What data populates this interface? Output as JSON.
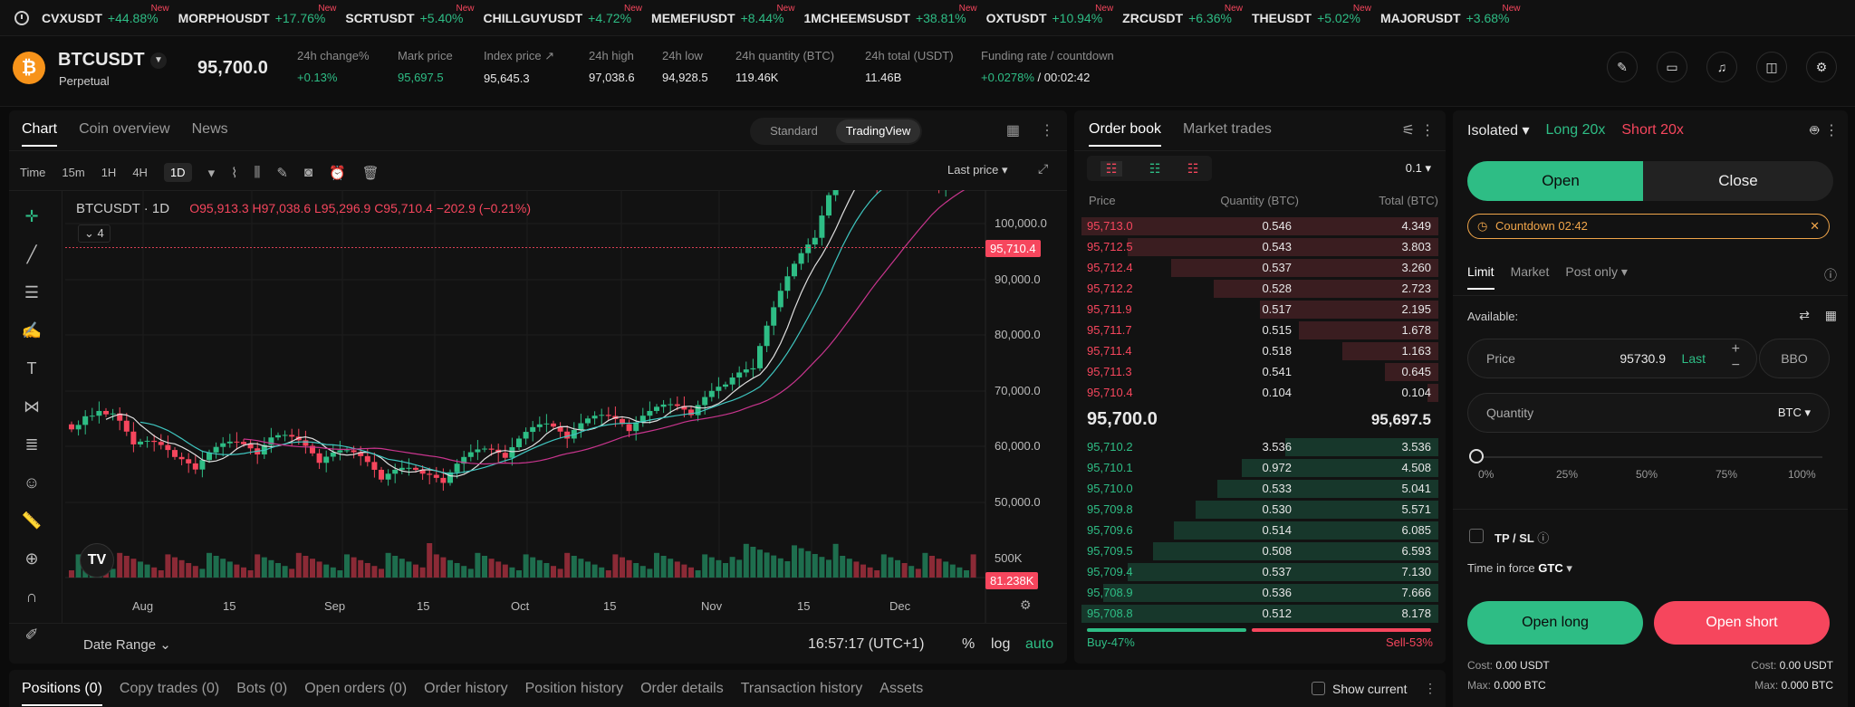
{
  "ticker": [
    {
      "sym": "CVXUSDT",
      "chg": "+44.88%",
      "new": "New"
    },
    {
      "sym": "MORPHOUSDT",
      "chg": "+17.76%",
      "new": "New"
    },
    {
      "sym": "SCRTUSDT",
      "chg": "+5.40%",
      "new": "New"
    },
    {
      "sym": "CHILLGUYUSDT",
      "chg": "+4.72%",
      "new": "New"
    },
    {
      "sym": "MEMEFIUSDT",
      "chg": "+8.44%",
      "new": "New"
    },
    {
      "sym": "1MCHEEMSUSDT",
      "chg": "+38.81%",
      "new": "New"
    },
    {
      "sym": "OXTUSDT",
      "chg": "+10.94%",
      "new": "New"
    },
    {
      "sym": "ZRCUSDT",
      "chg": "+6.36%",
      "new": "New"
    },
    {
      "sym": "THEUSDT",
      "chg": "+5.02%",
      "new": "New"
    },
    {
      "sym": "MAJORUSDT",
      "chg": "+3.68%",
      "new": "New"
    }
  ],
  "header": {
    "symbol": "BTCUSDT",
    "type": "Perpetual",
    "last": "95,700.0",
    "stats": [
      {
        "label": "24h change%",
        "value": "+0.13%",
        "color": "green"
      },
      {
        "label": "Mark price",
        "value": "95,697.5",
        "color": "green"
      },
      {
        "label": "Index price",
        "value": "95,645.3",
        "color": ""
      },
      {
        "label": "24h high",
        "value": "97,038.6",
        "color": ""
      },
      {
        "label": "24h low",
        "value": "94,928.5",
        "color": ""
      },
      {
        "label": "24h quantity (BTC)",
        "value": "119.46K",
        "color": ""
      },
      {
        "label": "24h total (USDT)",
        "value": "11.46B",
        "color": ""
      }
    ],
    "funding": {
      "label": "Funding rate / countdown",
      "rate": "+0.0278%",
      "countdown": "/ 00:02:42"
    }
  },
  "chart": {
    "tabs": [
      "Chart",
      "Coin overview",
      "News"
    ],
    "views": [
      "Standard",
      "TradingView"
    ],
    "timeframes": [
      "Time",
      "15m",
      "1H",
      "4H",
      "1D"
    ],
    "price_mode": "Last price",
    "title": "BTCUSDT · 1D",
    "ohlc": "O95,913.3  H97,038.6  L95,296.9  C95,710.4  −202.9 (−0.21%)",
    "indicator_count": "4",
    "yticks": [
      "100,000.0",
      "90,000.0",
      "80,000.0",
      "70,000.0",
      "60,000.0",
      "50,000.0",
      "500K"
    ],
    "xticks": [
      "Aug",
      "15",
      "Sep",
      "15",
      "Oct",
      "15",
      "Nov",
      "15",
      "Dec"
    ],
    "price_tag": "95,710.4",
    "volume_tag": "81.238K",
    "date_range": "Date Range",
    "clock": "16:57:17 (UTC+1)",
    "scale": [
      "%",
      "log",
      "auto"
    ]
  },
  "orderbook": {
    "tabs": [
      "Order book",
      "Market trades"
    ],
    "precision": "0.1",
    "cols": [
      "Price",
      "Quantity (BTC)",
      "Total (BTC)"
    ],
    "asks": [
      {
        "p": "95,713.0",
        "q": "0.546",
        "t": "4.349",
        "d": 1.0
      },
      {
        "p": "95,712.5",
        "q": "0.543",
        "t": "3.803",
        "d": 0.87
      },
      {
        "p": "95,712.4",
        "q": "0.537",
        "t": "3.260",
        "d": 0.75
      },
      {
        "p": "95,712.2",
        "q": "0.528",
        "t": "2.723",
        "d": 0.63
      },
      {
        "p": "95,711.9",
        "q": "0.517",
        "t": "2.195",
        "d": 0.5
      },
      {
        "p": "95,711.7",
        "q": "0.515",
        "t": "1.678",
        "d": 0.39
      },
      {
        "p": "95,711.4",
        "q": "0.518",
        "t": "1.163",
        "d": 0.27
      },
      {
        "p": "95,711.3",
        "q": "0.541",
        "t": "0.645",
        "d": 0.15
      },
      {
        "p": "95,710.4",
        "q": "0.104",
        "t": "0.104",
        "d": 0.03
      }
    ],
    "mid": "95,700.0",
    "mark": "95,697.5",
    "bids": [
      {
        "p": "95,710.2",
        "q": "3.536",
        "t": "3.536",
        "d": 0.43
      },
      {
        "p": "95,710.1",
        "q": "0.972",
        "t": "4.508",
        "d": 0.55
      },
      {
        "p": "95,710.0",
        "q": "0.533",
        "t": "5.041",
        "d": 0.62
      },
      {
        "p": "95,709.8",
        "q": "0.530",
        "t": "5.571",
        "d": 0.68
      },
      {
        "p": "95,709.6",
        "q": "0.514",
        "t": "6.085",
        "d": 0.74
      },
      {
        "p": "95,709.5",
        "q": "0.508",
        "t": "6.593",
        "d": 0.8
      },
      {
        "p": "95,709.4",
        "q": "0.537",
        "t": "7.130",
        "d": 0.87
      },
      {
        "p": "95,708.9",
        "q": "0.536",
        "t": "7.666",
        "d": 0.94
      },
      {
        "p": "95,708.8",
        "q": "0.512",
        "t": "8.178",
        "d": 1.0
      }
    ],
    "buy": "Buy-47%",
    "sell": "Sell-53%",
    "buy_ratio": 0.47
  },
  "trade": {
    "margin": "Isolated",
    "long": "Long 20x",
    "short": "Short 20x",
    "open": "Open",
    "close": "Close",
    "countdown": "Countdown 02:42",
    "order_types": [
      "Limit",
      "Market",
      "Post only"
    ],
    "available": "Available:",
    "price_label": "Price",
    "price_value": "95730.9",
    "price_last": "Last",
    "bbo": "BBO",
    "qty_label": "Quantity",
    "qty_unit": "BTC",
    "pcts": [
      "0%",
      "25%",
      "50%",
      "75%",
      "100%"
    ],
    "tpsl": "TP / SL",
    "tif_label": "Time in force",
    "tif_value": "GTC",
    "open_long": "Open long",
    "open_short": "Open short",
    "cost_l": "Cost:",
    "cost_lv": "0.00 USDT",
    "cost_r": "Cost:",
    "cost_rv": "0.00 USDT",
    "max_l": "Max:",
    "max_lv": "0.000 BTC",
    "max_r": "Max:",
    "max_rv": "0.000 BTC"
  },
  "bottom": {
    "tabs": [
      "Positions (0)",
      "Copy trades (0)",
      "Bots (0)",
      "Open orders (0)",
      "Order history",
      "Position history",
      "Order details",
      "Transaction history",
      "Assets"
    ],
    "show_current": "Show current"
  },
  "colors": {
    "green": "#2ebd85",
    "red": "#f6465d",
    "orange": "#f0a54a",
    "ma1": "#e0e0e0",
    "ma2": "#3fc6c0",
    "ma3": "#c9358e"
  }
}
